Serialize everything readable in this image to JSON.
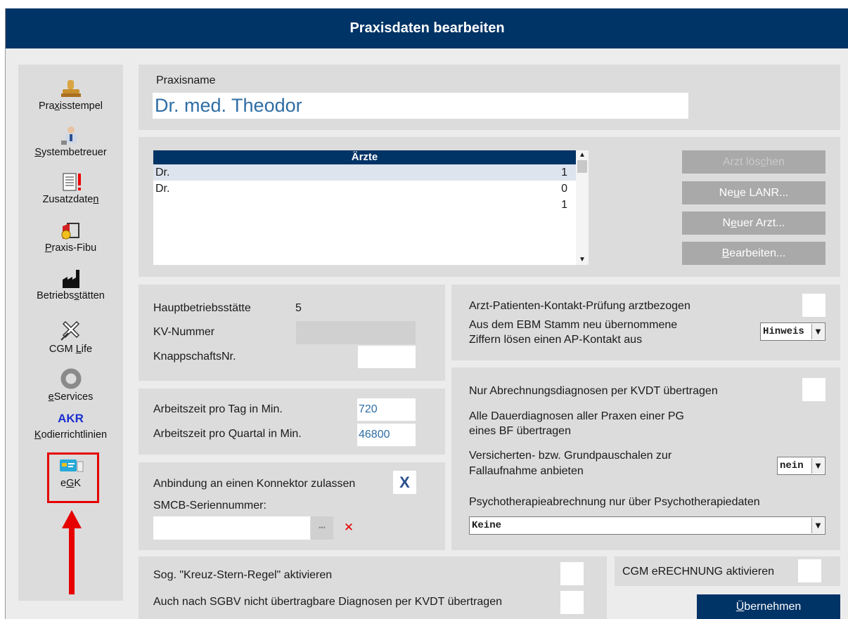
{
  "window": {
    "title": "Praxisdaten bearbeiten"
  },
  "sidebar": {
    "items": [
      {
        "pre": "Pra",
        "u": "x",
        "post": "isstempel",
        "icon": "stamp-icon"
      },
      {
        "pre": "",
        "u": "S",
        "post": "ystembetreuer",
        "icon": "technician-icon"
      },
      {
        "pre": "Zusatzdate",
        "u": "n",
        "post": "",
        "icon": "document-exclamation-icon"
      },
      {
        "pre": "",
        "u": "P",
        "post": "raxis-Fibu",
        "icon": "accounting-book-icon"
      },
      {
        "pre": "Betriebs",
        "u": "s",
        "post": "tätten",
        "icon": "factory-icon"
      },
      {
        "pre": "CGM ",
        "u": "L",
        "post": "ife",
        "icon": "cgm-life-icon"
      },
      {
        "pre": "",
        "u": "e",
        "post": "Services",
        "icon": "ring-icon"
      },
      {
        "pre": "",
        "u": "K",
        "post": "odierrichtlinien",
        "icon": "akr-icon",
        "icon_text": "AKR"
      },
      {
        "pre": "e",
        "u": "G",
        "post": "K",
        "icon": "health-card-icon"
      }
    ]
  },
  "praxis": {
    "name_label": "Praxisname",
    "name_value": "Dr. med. Theodor"
  },
  "doctors": {
    "header": "Ärzte",
    "rows": [
      {
        "name": "Dr.",
        "value": "1"
      },
      {
        "name": "Dr.",
        "value": "0"
      },
      {
        "name": "",
        "value": "1"
      }
    ]
  },
  "buttons": {
    "delete": {
      "pre": "Arzt lös",
      "u": "c",
      "post": "hen"
    },
    "new_lanr": {
      "pre": "Ne",
      "u": "u",
      "post": "e LANR..."
    },
    "new_doctor": {
      "pre": "N",
      "u": "e",
      "post": "uer Arzt..."
    },
    "edit": {
      "pre": "",
      "u": "B",
      "post": "earbeiten..."
    },
    "apply": {
      "pre": "",
      "u": "Ü",
      "post": "bernehmen"
    }
  },
  "betrieb": {
    "haupt_label": "Hauptbetriebsstätte",
    "haupt_value": "5",
    "kv_label": "KV-Nummer",
    "kv_value": "",
    "knapp_label": "KnappschaftsNr.",
    "knapp_value": ""
  },
  "arbeitszeit": {
    "tag_label": "Arbeitszeit pro Tag in Min.",
    "tag_value": "720",
    "quartal_label": "Arbeitszeit pro Quartal in Min.",
    "quartal_value": "46800"
  },
  "konnektor": {
    "allow_label": "Anbindung an einen Konnektor zulassen",
    "allow_mark": "X",
    "smcb_label": "SMCB-Seriennummer:",
    "smcb_value": "",
    "browse": "•••",
    "clear": "✕"
  },
  "ap_kontakt": {
    "pruefung_label": "Arzt-Patienten-Kontakt-Prüfung arztbezogen",
    "ebm_label_1": "Aus dem EBM Stamm neu übernommene",
    "ebm_label_2": "Ziffern lösen einen AP-Kontakt aus",
    "ebm_value": "Hinweis"
  },
  "kvdt": {
    "abr_label": "Nur Abrechnungsdiagnosen per KVDT übertragen",
    "dauer_label_1": "Alle Dauerdiagnosen aller Praxen einer PG",
    "dauer_label_2": "eines BF übertragen",
    "pausch_label_1": "Versicherten- bzw. Grundpauschalen zur",
    "pausch_label_2": "Fallaufnahme anbieten",
    "pausch_value": "nein",
    "psycho_label": "Psychotherapieabrechnung nur über Psychotherapiedaten",
    "psycho_value": "Keine"
  },
  "bottom": {
    "kreuz_label": "Sog. \"Kreuz-Stern-Regel\" aktivieren",
    "sgbv_label": "Auch nach SGBV nicht übertragbare Diagnosen per KVDT übertragen",
    "erechnung_label": "CGM eRECHNUNG aktivieren"
  },
  "colors": {
    "titlebar": "#003366",
    "accent_text": "#2e6da4",
    "highlight": "#e60000",
    "button_disabled": "#a9a9a9"
  }
}
